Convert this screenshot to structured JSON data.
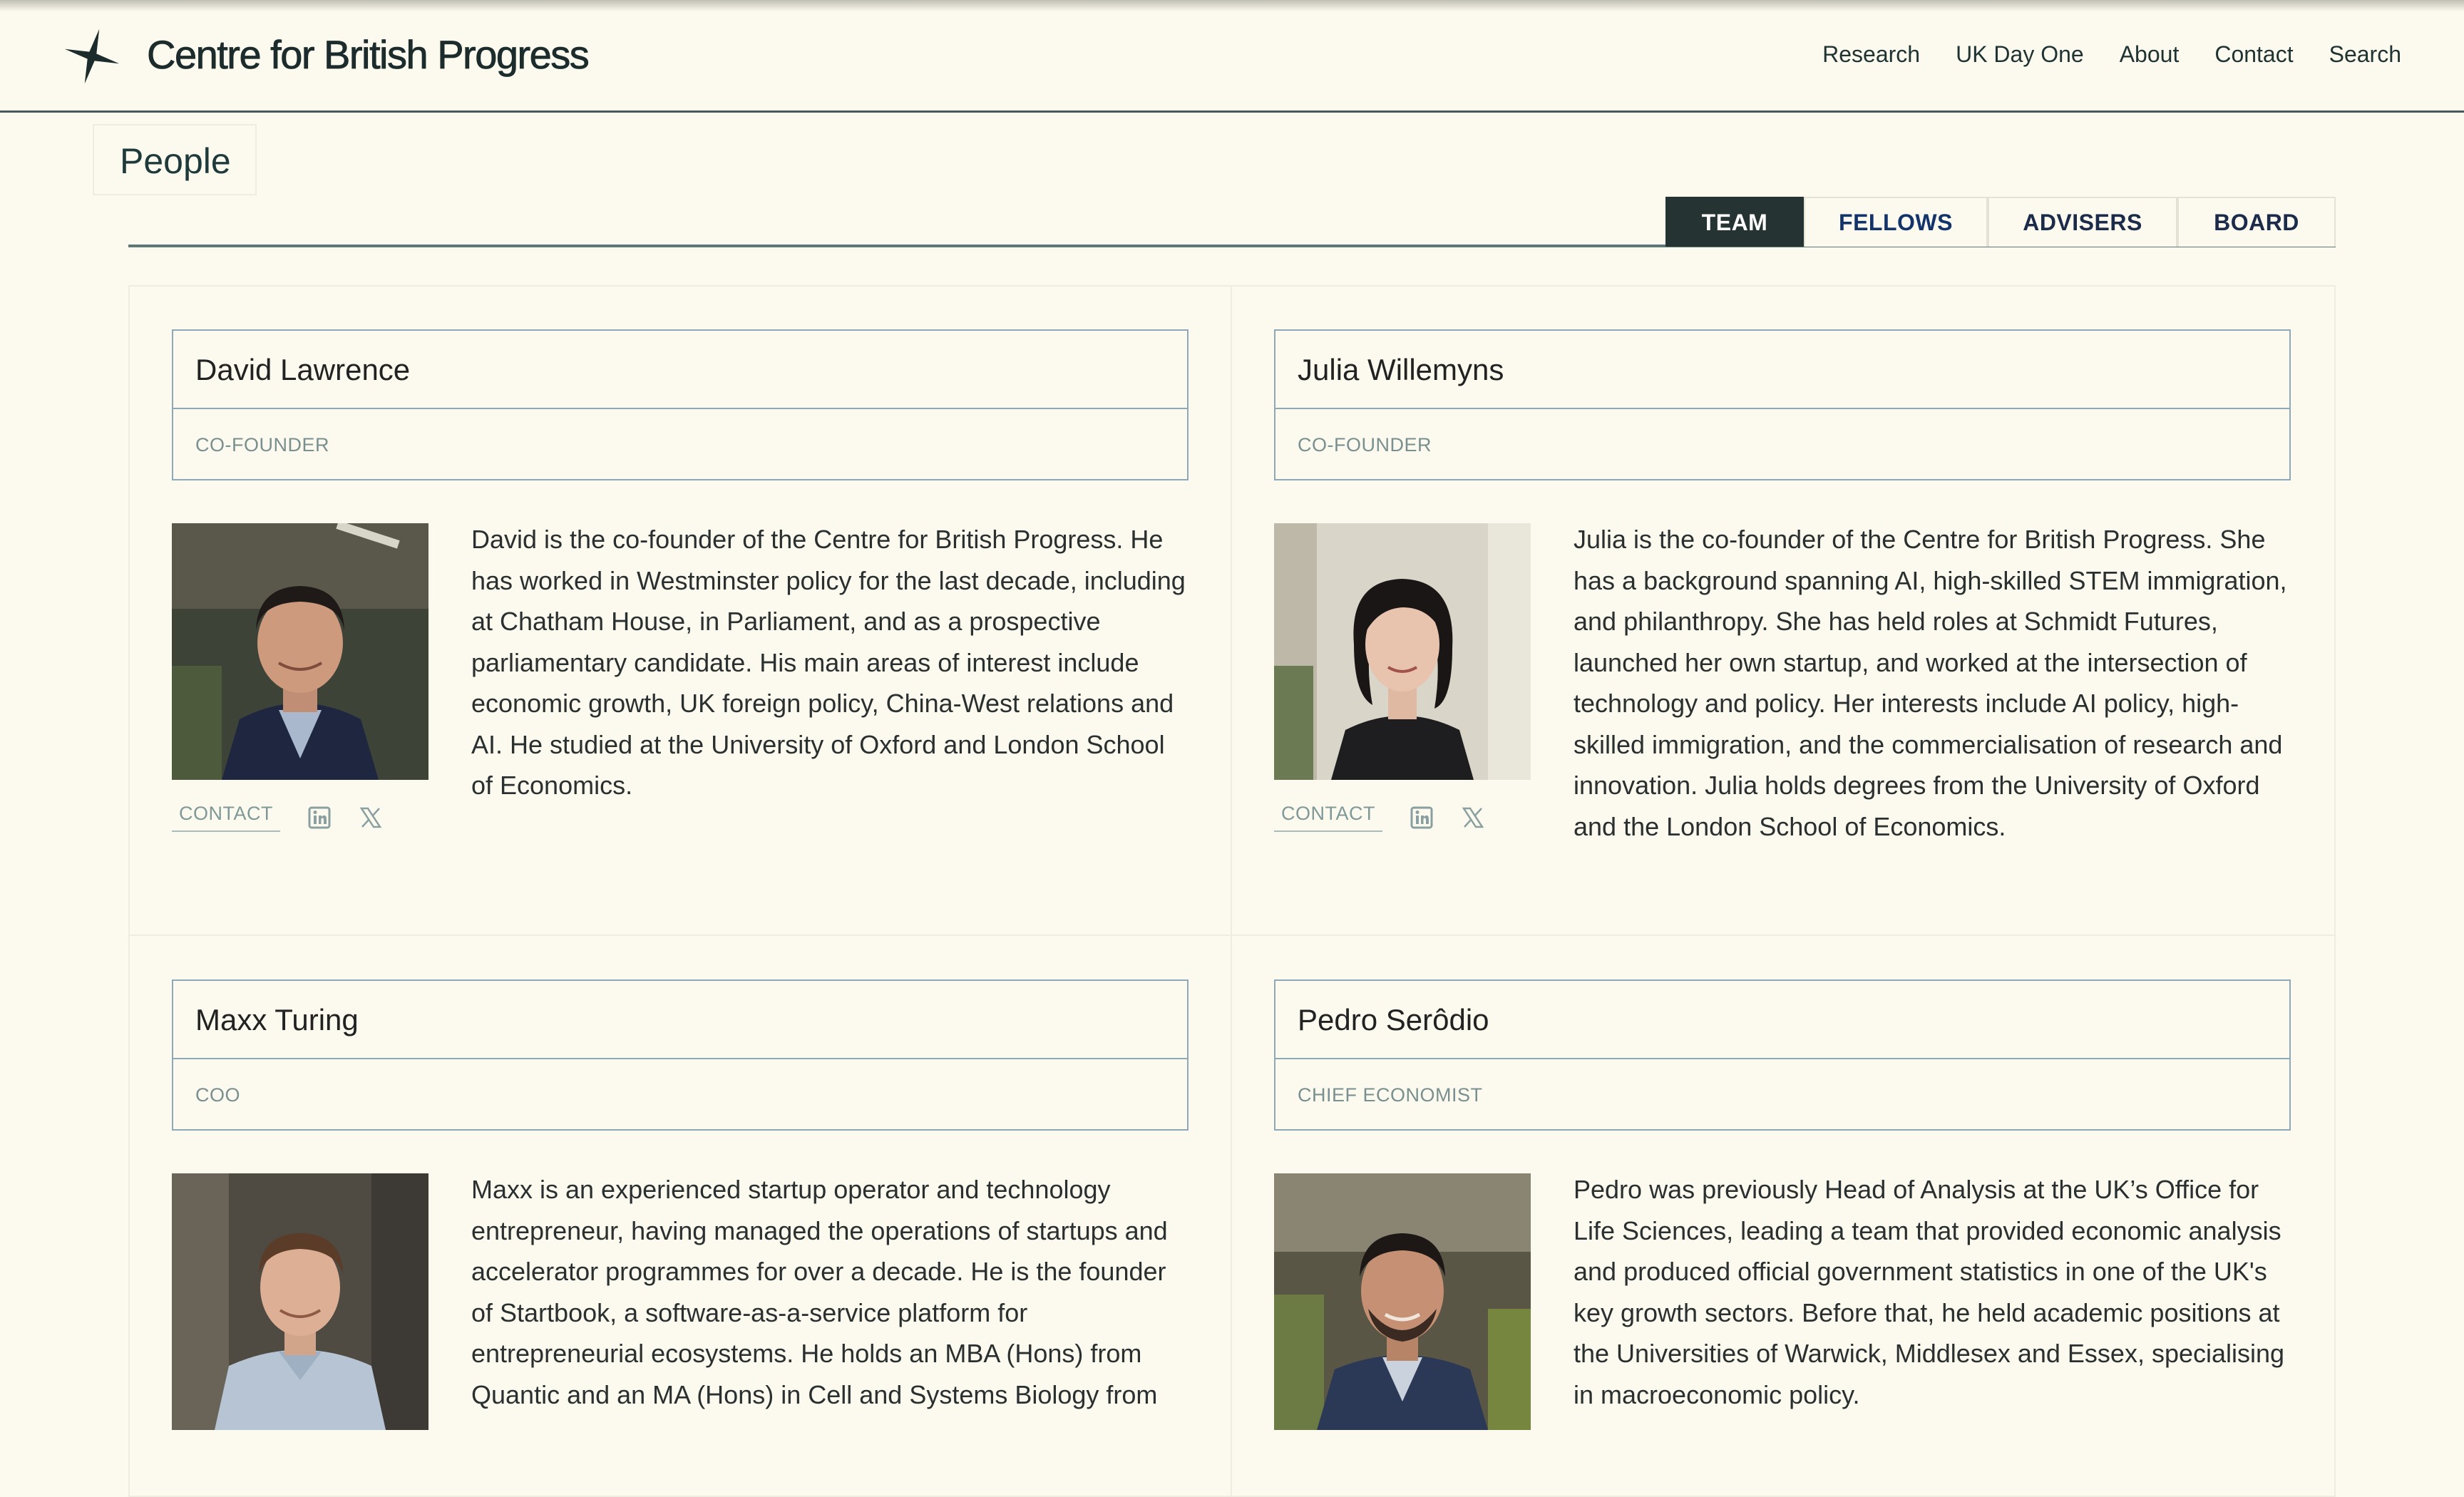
{
  "site": {
    "title": "Centre for British Progress",
    "logo_icon": "four-point-star-icon"
  },
  "nav": {
    "items": [
      {
        "label": "Research"
      },
      {
        "label": "UK Day One"
      },
      {
        "label": "About"
      },
      {
        "label": "Contact"
      },
      {
        "label": "Search"
      }
    ]
  },
  "page": {
    "heading": "People"
  },
  "tabs": [
    {
      "label": "TEAM",
      "active": true
    },
    {
      "label": "FELLOWS",
      "active": false
    },
    {
      "label": "ADVISERS",
      "active": false
    },
    {
      "label": "BOARD",
      "active": false
    }
  ],
  "people": [
    {
      "name": "David Lawrence",
      "role": "CO-FOUNDER",
      "bio": "David is the co-founder of the Centre for British Progress. He has worked in Westminster policy for the last decade, including at Chatham House, in Parliament, and as a prospective parliamentary candidate. His main areas of interest include economic growth, UK foreign policy, China-West relations and AI. He studied at the University of Oxford and London School of Economics.",
      "contact_label": "CONTACT",
      "social": [
        "linkedin-icon",
        "x-icon"
      ]
    },
    {
      "name": "Julia Willemyns",
      "role": "CO-FOUNDER",
      "bio": "Julia is the co-founder of the Centre for British Progress. She has a background spanning AI, high-skilled STEM immigration, and philanthropy. She has held roles at Schmidt Futures, launched her own startup, and worked at the intersection of technology and policy. Her interests include AI policy, high-skilled immigration, and the commercialisation of research and innovation. Julia holds degrees from the University of Oxford and the London School of Economics.",
      "contact_label": "CONTACT",
      "social": [
        "linkedin-icon",
        "x-icon"
      ]
    },
    {
      "name": "Maxx Turing",
      "role": "COO",
      "bio": "Maxx is an experienced startup operator and technology entrepreneur, having managed the operations of startups and accelerator programmes for over a decade. He is the founder of Startbook, a software-as-a-service platform for entrepreneurial ecosystems. He holds an MBA (Hons) from Quantic and an MA (Hons) in Cell and Systems Biology from"
    },
    {
      "name": "Pedro Serôdio",
      "role": "CHIEF ECONOMIST",
      "bio": "Pedro was previously Head of Analysis at the UK’s Office for Life Sciences, leading a team that provided economic analysis and produced official government statistics in one of the UK's key growth sectors. Before that, he held academic positions at the Universities of Warwick, Middlesex and Essex, specialising in macroeconomic policy."
    }
  ],
  "colors": {
    "background": "#fcfaee",
    "active_tab": "#263333",
    "card_border": "#8fa8b8",
    "muted_text": "#7a9090"
  }
}
